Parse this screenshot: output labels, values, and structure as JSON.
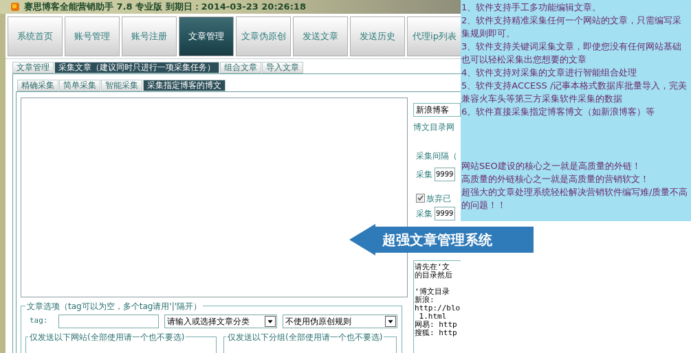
{
  "window": {
    "title": "赛思博客全能营销助手 7.8 专业版 到期日：2014-03-23 20:26:18"
  },
  "main_tabs": [
    {
      "label": "系统首页",
      "selected": false
    },
    {
      "label": "账号管理",
      "selected": false
    },
    {
      "label": "账号注册",
      "selected": false
    },
    {
      "label": "文章管理",
      "selected": true
    },
    {
      "label": "文章伪原创",
      "selected": false
    },
    {
      "label": "发送文章",
      "selected": false
    },
    {
      "label": "发送历史",
      "selected": false
    },
    {
      "label": "代理ip列表",
      "selected": false
    }
  ],
  "sub_tabs": [
    {
      "label": "文章管理",
      "selected": false
    },
    {
      "label": "采集文章（建议同时只进行一项采集任务）",
      "selected": true
    },
    {
      "label": "组合文章",
      "selected": false
    },
    {
      "label": "导入文章",
      "selected": false
    }
  ],
  "collect_tabs": [
    {
      "label": "精确采集",
      "selected": false
    },
    {
      "label": "简单采集",
      "selected": false
    },
    {
      "label": "智能采集",
      "selected": false
    },
    {
      "label": "采集指定博客的博文",
      "selected": true
    }
  ],
  "side_panel": {
    "blog_select": "新浪博客",
    "url_label": "博文目录网",
    "interval_label": "采集间隔（",
    "collect_label": "采集",
    "collect_value": "9999",
    "skip_checkbox": {
      "label": "放弃已",
      "checked": true
    },
    "collect_label_2": "采集",
    "collect_value_2": "9999",
    "help_blocks": [
      [
        "请先在‘文",
        "的目录然后"
      ],
      [
        "‘博文目录",
        "新浪:",
        "http://blo",
        " 1.html",
        "网易: http",
        "搜狐: http"
      ]
    ]
  },
  "article_options": {
    "legend": "文章选项（tag可以为空，多个tag请用'|'隔开）",
    "tag_label": "tag:",
    "category": "请输入或选择文章分类",
    "rewrite_rule": "不使用伪原创规则",
    "site_filter_legend": "仅发送以下网站(全部使用请一个也不要选)",
    "group_filter_legend": "仅发送以下分组(全部使用请一个也不要选)"
  },
  "info_panel": {
    "features": [
      "1、软件支持手工多功能编辑文章。",
      "2、软件支持精准采集任何一个网站的文章，只需编写采集规则即可。",
      "3、软件支持关键词采集文章，即使您没有任何网站基础也可以轻松采集出您想要的文章",
      "4、软件支持对采集的文章进行智能组合处理",
      "5、软件支持ACCESS /记事本格式数据库批量导入，完美兼容火车头等第三方采集软件采集的数据",
      "6。软件直接采集指定博客博文（如新浪博客）等"
    ],
    "slogans": [
      "网站SEO建设的核心之一就是高质量的外链！",
      "高质量的外链核心之一就是高质量的营销软文！",
      "超强大的文章处理系统轻松解决营销软件编写难/质量不高的问题！！"
    ]
  },
  "callout": "超强文章管理系统"
}
